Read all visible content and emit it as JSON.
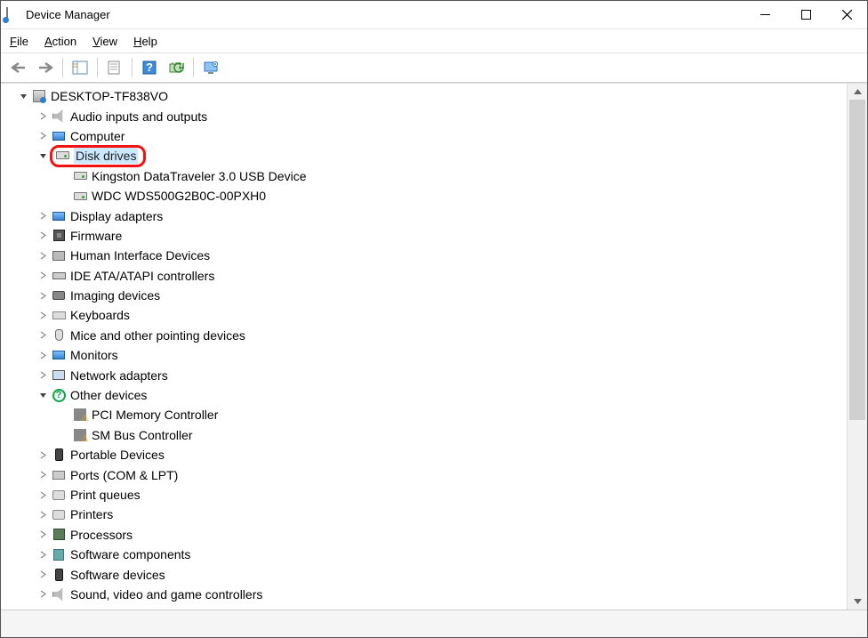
{
  "window": {
    "title": "Device Manager"
  },
  "menu": {
    "file": "File",
    "action": "Action",
    "view": "View",
    "help": "Help"
  },
  "tree": {
    "root": "DESKTOP-TF838VO",
    "audio": "Audio inputs and outputs",
    "computer": "Computer",
    "disk_drives": "Disk drives",
    "disk_child_1": "Kingston DataTraveler 3.0 USB Device",
    "disk_child_2": "WDC WDS500G2B0C-00PXH0",
    "display": "Display adapters",
    "firmware": "Firmware",
    "hid": "Human Interface Devices",
    "ide": "IDE ATA/ATAPI controllers",
    "imaging": "Imaging devices",
    "keyboards": "Keyboards",
    "mice": "Mice and other pointing devices",
    "monitors": "Monitors",
    "network": "Network adapters",
    "other": "Other devices",
    "other_child_1": "PCI Memory Controller",
    "other_child_2": "SM Bus Controller",
    "portable": "Portable Devices",
    "ports": "Ports (COM & LPT)",
    "print_queues": "Print queues",
    "printers": "Printers",
    "processors": "Processors",
    "sw_components": "Software components",
    "sw_devices": "Software devices",
    "sound": "Sound, video and game controllers"
  }
}
